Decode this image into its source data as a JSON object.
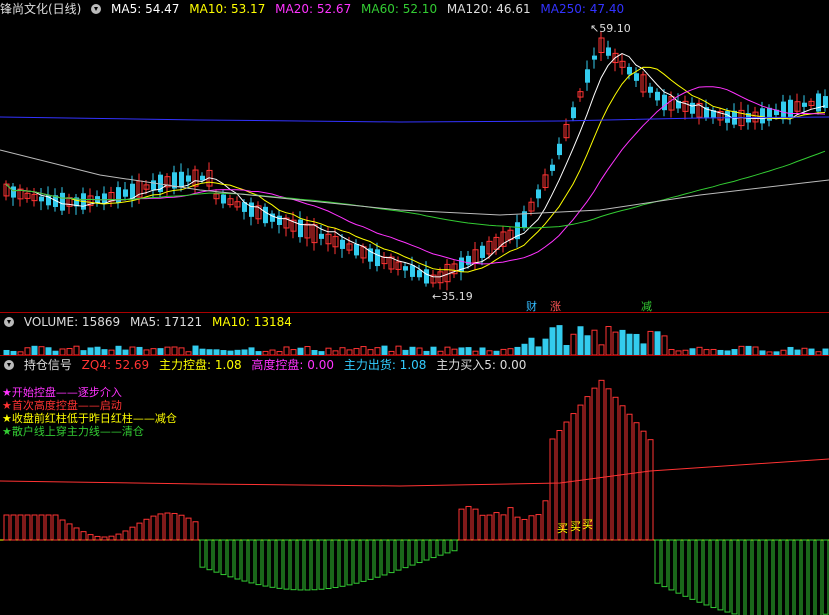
{
  "main": {
    "title": "锋尚文化(日线)",
    "ma": [
      {
        "label": "MA5: 54.47",
        "color": "#ffffff"
      },
      {
        "label": "MA10: 53.17",
        "color": "#ffff00"
      },
      {
        "label": "MA20: 52.67",
        "color": "#ff33ff"
      },
      {
        "label": "MA60: 52.10",
        "color": "#33cc33"
      },
      {
        "label": "MA120: 46.61",
        "color": "#dddddd"
      },
      {
        "label": "MA250: 47.40",
        "color": "#3333ff"
      }
    ],
    "high_label": "59.10",
    "low_label": "35.19",
    "badges": [
      {
        "text": "财",
        "color": "#33bbff"
      },
      {
        "text": "涨",
        "color": "#ff5555"
      },
      {
        "text": "减",
        "color": "#33cc33"
      }
    ]
  },
  "volume": {
    "label": "VOLUME: 15869",
    "ma5": "MA5: 17121",
    "ma10": "MA10: 13184"
  },
  "signal": {
    "title": "持仓信号",
    "items": [
      {
        "label": "ZQ4: 52.69",
        "color": "#ff3333"
      },
      {
        "label": "主力控盘: 1.08",
        "color": "#ffff00"
      },
      {
        "label": "高度控盘: 0.00",
        "color": "#ff33ff"
      },
      {
        "label": "主力出货: 1.08",
        "color": "#33ccff"
      },
      {
        "label": "主力买入5: 0.00",
        "color": "#dddddd"
      }
    ],
    "legend": [
      {
        "star": "★",
        "text": "开始控盘——逐步介入",
        "color": "#ff33ff"
      },
      {
        "star": "★",
        "text": "首次高度控盘——启动",
        "color": "#ff3333"
      },
      {
        "star": "★",
        "text": "收盘前红柱低于昨日红柱——减仓",
        "color": "#ffff00"
      },
      {
        "star": "★",
        "text": "散户线上穿主力线——清仓",
        "color": "#33cc33"
      }
    ],
    "buy_marks": [
      "买",
      "买",
      "买"
    ]
  }
}
